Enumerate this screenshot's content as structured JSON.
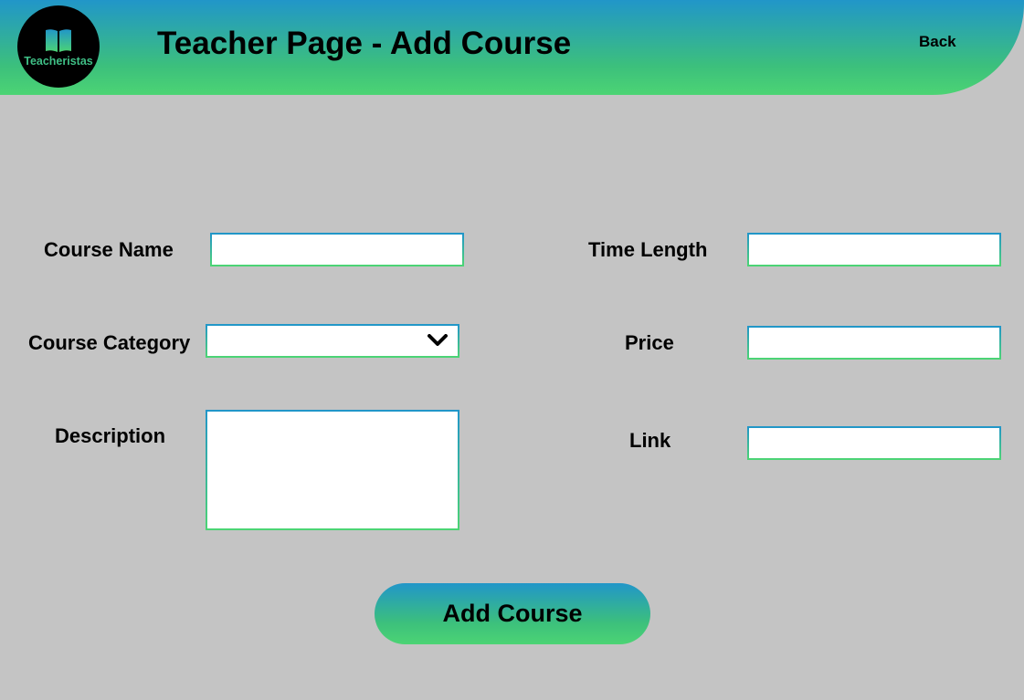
{
  "brand": {
    "name": "Teacheristas",
    "icon": "open-book-icon"
  },
  "header": {
    "title": "Teacher Page - Add Course",
    "back_label": "Back"
  },
  "form": {
    "course_name": {
      "label": "Course Name",
      "value": ""
    },
    "course_category": {
      "label": "Course Category",
      "selected": "",
      "icon": "chevron-down-icon"
    },
    "description": {
      "label": "Description",
      "value": ""
    },
    "time_length": {
      "label": "Time Length",
      "value": ""
    },
    "price": {
      "label": "Price",
      "value": ""
    },
    "link": {
      "label": "Link",
      "value": ""
    },
    "submit_label": "Add Course"
  },
  "colors": {
    "gradient_top": "#2196c9",
    "gradient_bottom": "#4cd474",
    "background": "#c4c4c4"
  }
}
